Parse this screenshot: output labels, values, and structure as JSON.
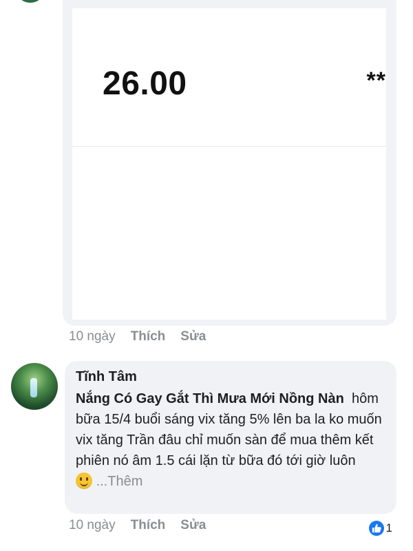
{
  "comment1": {
    "card": {
      "value": "26.00",
      "marker": "**"
    },
    "time": "10 ngày",
    "like_label": "Thích",
    "edit_label": "Sửa"
  },
  "comment2": {
    "author": "Tĩnh Tâm",
    "tag": "Nắng Có Gay Gắt Thì Mưa Mới Nồng Nàn",
    "text": "hôm bữa 15/4 buổi sáng vix tăng 5% lên ba la ko muốn vix tăng Trần đâu chỉ muốn sàn để mua thêm kết phiên nó âm 1.5 cái lặn từ bữa đó tới giờ luôn",
    "emoji": "grinning-face",
    "more_label": "...Thêm",
    "time": "10 ngày",
    "like_label": "Thích",
    "edit_label": "Sửa",
    "reaction_count": "1",
    "reaction_icon": "like-icon"
  },
  "colors": {
    "bubble": "#f0f2f5",
    "muted_text": "#8a8d91",
    "like_blue": "#1877f2"
  }
}
